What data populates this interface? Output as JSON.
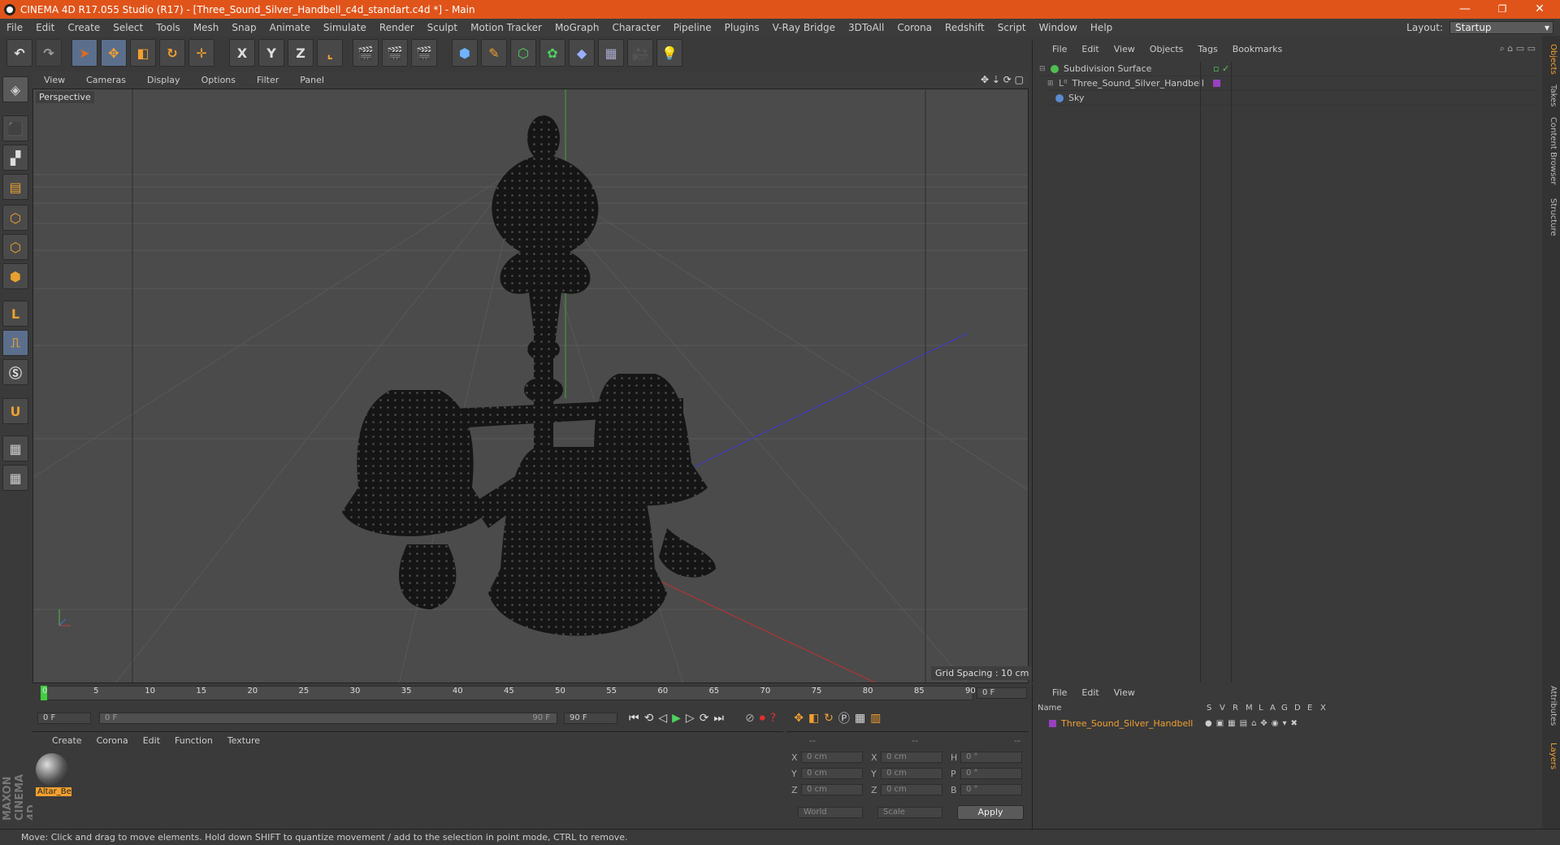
{
  "window": {
    "title": "CINEMA 4D R17.055 Studio (R17) - [Three_Sound_Silver_Handbell_c4d_standart.c4d *] - Main",
    "minimize": "—",
    "restore": "❐",
    "close": "✕"
  },
  "menu": [
    "File",
    "Edit",
    "Create",
    "Select",
    "Tools",
    "Mesh",
    "Snap",
    "Animate",
    "Simulate",
    "Render",
    "Sculpt",
    "Motion Tracker",
    "MoGraph",
    "Character",
    "Pipeline",
    "Plugins",
    "V-Ray Bridge",
    "3DToAll",
    "Corona",
    "Redshift",
    "Script",
    "Window",
    "Help"
  ],
  "layout": {
    "label": "Layout:",
    "value": "Startup"
  },
  "toolbar": {
    "x_axis": "X",
    "y_axis": "Y",
    "z_axis": "Z"
  },
  "viewport": {
    "menu": [
      "View",
      "Cameras",
      "Display",
      "Options",
      "Filter",
      "Panel"
    ],
    "camera_label": "Perspective",
    "grid_spacing": "Grid Spacing : 10 cm"
  },
  "timeline": {
    "ticks": [
      "0",
      "5",
      "10",
      "15",
      "20",
      "25",
      "30",
      "35",
      "40",
      "45",
      "50",
      "55",
      "60",
      "65",
      "70",
      "75",
      "80",
      "85",
      "90"
    ],
    "current_frame": "0 F",
    "start_frame": "0 F",
    "range_start": "0 F",
    "range_end": "90 F",
    "end_frame": "90 F"
  },
  "material_panel": {
    "menu": [
      "Create",
      "Corona",
      "Edit",
      "Function",
      "Texture"
    ],
    "materials": [
      {
        "name": "Altar_Be"
      }
    ]
  },
  "coord_panel": {
    "headers": [
      "--",
      "--",
      "--"
    ],
    "rows": [
      {
        "a": "X",
        "av": "0 cm",
        "b": "X",
        "bv": "0 cm",
        "c": "H",
        "cv": "0 °"
      },
      {
        "a": "Y",
        "av": "0 cm",
        "b": "Y",
        "bv": "0 cm",
        "c": "P",
        "cv": "0 °"
      },
      {
        "a": "Z",
        "av": "0 cm",
        "b": "Z",
        "bv": "0 cm",
        "c": "B",
        "cv": "0 °"
      }
    ],
    "world": "World",
    "scale": "Scale",
    "apply": "Apply"
  },
  "object_manager": {
    "menu": [
      "File",
      "Edit",
      "View",
      "Objects",
      "Tags",
      "Bookmarks"
    ],
    "objects": [
      {
        "name": "Subdivision Surface",
        "color": "#4fbf4f"
      },
      {
        "name": "Three_Sound_Silver_Handbell",
        "color": "#9a40c0"
      },
      {
        "name": "Sky",
        "color": "#5a8ad0"
      }
    ]
  },
  "layers_manager": {
    "menu": [
      "File",
      "Edit",
      "View"
    ],
    "columns": [
      "Name",
      "S",
      "V",
      "R",
      "M",
      "L",
      "A",
      "G",
      "D",
      "E",
      "X"
    ],
    "rows": [
      {
        "name": "Three_Sound_Silver_Handbell",
        "color": "#9a40c0"
      }
    ]
  },
  "side_tabs": [
    "Objects",
    "Takes",
    "Content Browser",
    "Structure",
    "Attributes",
    "Layers"
  ],
  "brand": "MAXON CINEMA 4D",
  "status": "Move: Click and drag to move elements. Hold down SHIFT to quantize movement / add to the selection in point mode, CTRL to remove."
}
